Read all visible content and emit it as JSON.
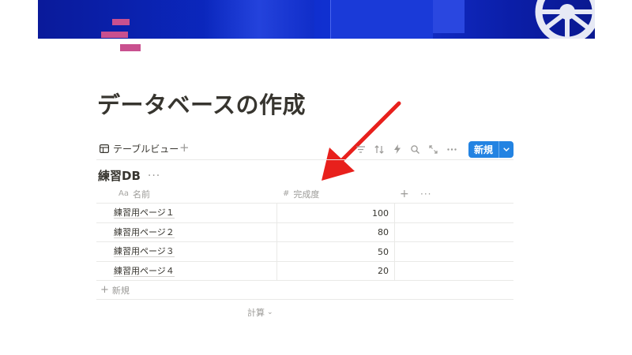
{
  "page": {
    "title": "データベースの作成"
  },
  "view": {
    "tab_label": "テーブルビュー",
    "add_view": "+"
  },
  "toolbar": {
    "new_label": "新規",
    "icons": [
      "filter-icon",
      "sort-icon",
      "automation-icon",
      "search-icon",
      "expand-icon",
      "more-icon"
    ]
  },
  "database": {
    "title": "練習DB",
    "more": "···"
  },
  "table": {
    "columns": [
      {
        "type_icon": "Aa",
        "label": "名前"
      },
      {
        "type_icon": "#",
        "label": "完成度"
      }
    ],
    "add_column": "+",
    "column_more": "···",
    "rows": [
      {
        "name": "練習用ページ１",
        "progress": "100"
      },
      {
        "name": "練習用ページ２",
        "progress": "80"
      },
      {
        "name": "練習用ページ３",
        "progress": "50"
      },
      {
        "name": "練習用ページ４",
        "progress": "20"
      }
    ],
    "new_row_label": "新規",
    "new_row_plus": "+",
    "calculate_label": "計算",
    "calculate_chevron": "⌄"
  },
  "colors": {
    "accent": "#2383e2",
    "arrow": "#e8201c",
    "icon": "#c9508f",
    "cover": "#0b2bc8"
  }
}
